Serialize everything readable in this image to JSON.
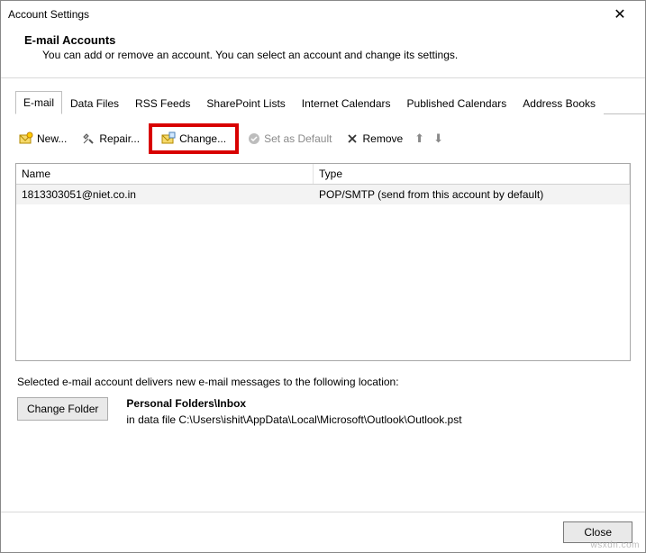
{
  "window": {
    "title": "Account Settings",
    "close_glyph": "✕"
  },
  "header": {
    "title": "E-mail Accounts",
    "desc": "You can add or remove an account. You can select an account and change its settings."
  },
  "tabs": [
    {
      "label": "E-mail",
      "active": true
    },
    {
      "label": "Data Files"
    },
    {
      "label": "RSS Feeds"
    },
    {
      "label": "SharePoint Lists"
    },
    {
      "label": "Internet Calendars"
    },
    {
      "label": "Published Calendars"
    },
    {
      "label": "Address Books"
    }
  ],
  "toolbar": {
    "new": "New...",
    "repair": "Repair...",
    "change": "Change...",
    "set_default": "Set as Default",
    "remove": "Remove"
  },
  "list": {
    "columns": {
      "name": "Name",
      "type": "Type"
    },
    "rows": [
      {
        "name": "1813303051@niet.co.in",
        "type": "POP/SMTP (send from this account by default)"
      }
    ]
  },
  "delivery": {
    "intro": "Selected e-mail account delivers new e-mail messages to the following location:",
    "change_folder": "Change Folder",
    "folder": "Personal Folders\\Inbox",
    "datafile": "in data file C:\\Users\\ishit\\AppData\\Local\\Microsoft\\Outlook\\Outlook.pst"
  },
  "footer": {
    "close": "Close"
  },
  "watermark": "wsxdn.com"
}
